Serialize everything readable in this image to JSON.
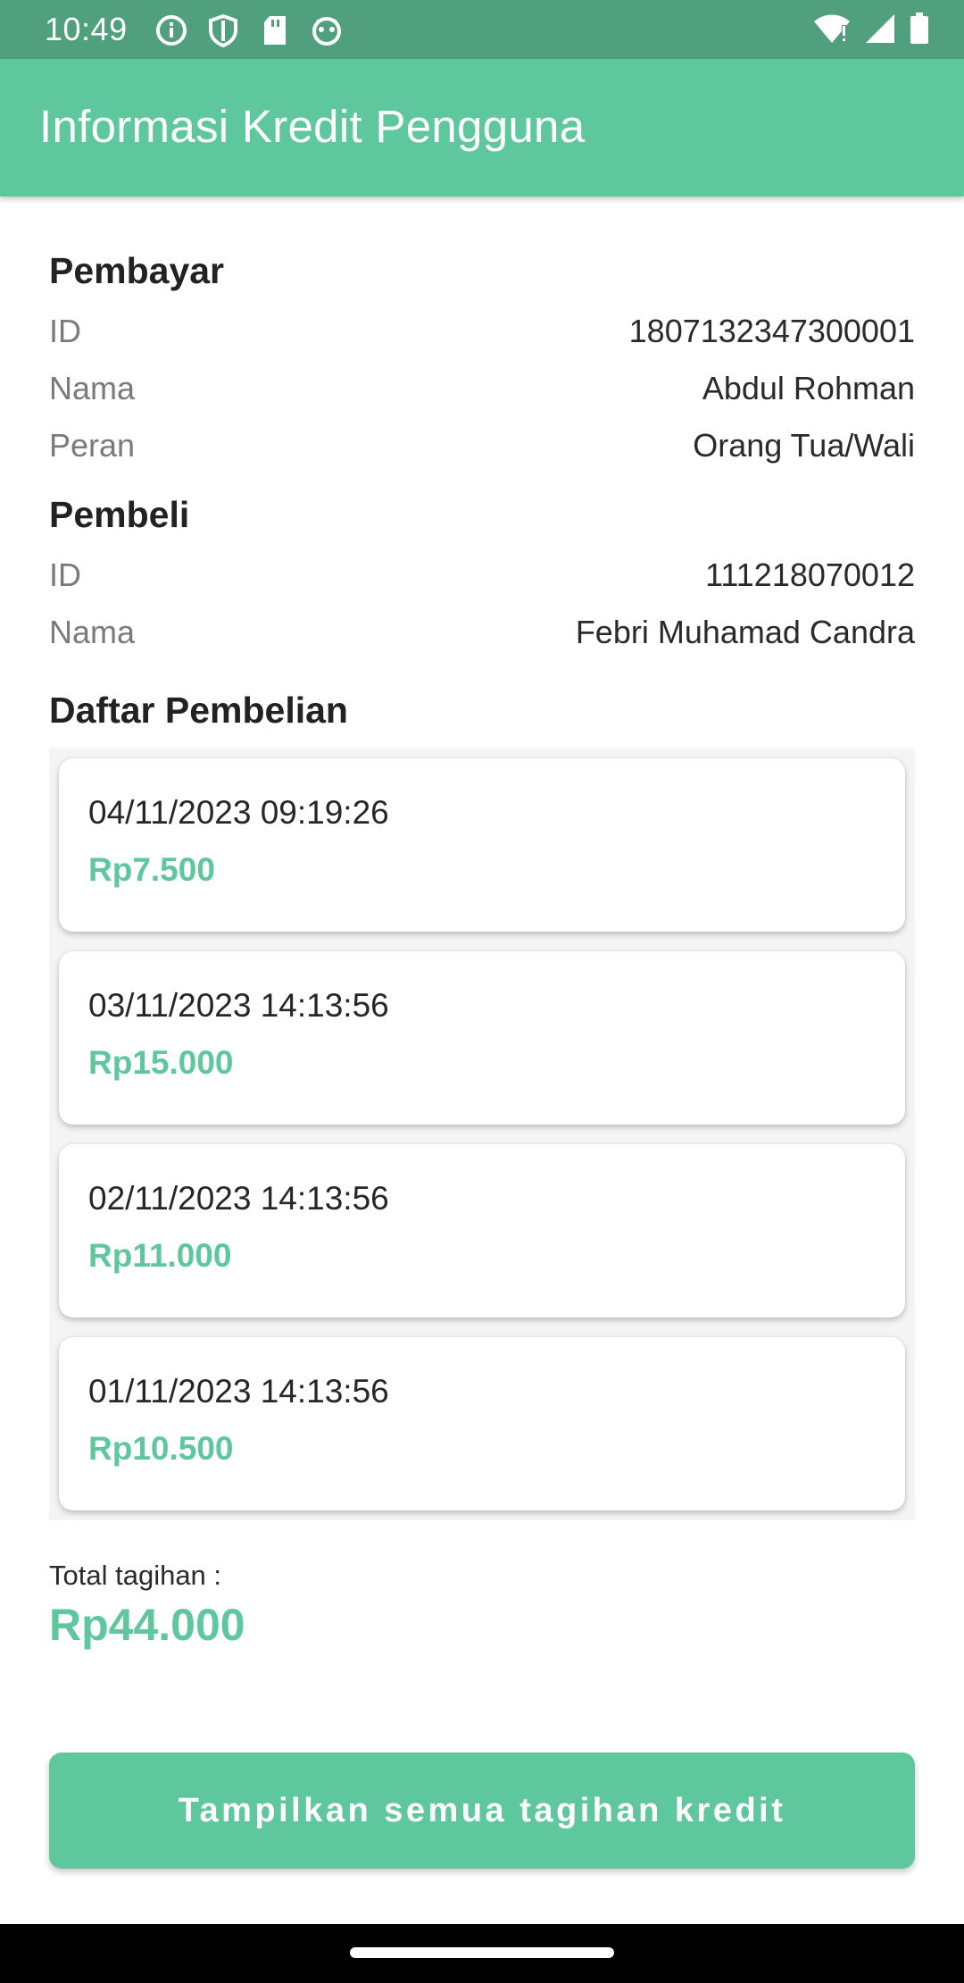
{
  "status_bar": {
    "time": "10:49",
    "left_icons": [
      "info-icon",
      "shield-icon",
      "sd-card-icon",
      "face-icon"
    ],
    "right_icons": [
      "wifi-alert-icon",
      "cell-signal-icon",
      "battery-icon"
    ]
  },
  "app_bar": {
    "title": "Informasi Kredit Pengguna"
  },
  "payer": {
    "title": "Pembayar",
    "id_label": "ID",
    "id_value": "1807132347300001",
    "name_label": "Nama",
    "name_value": "Abdul Rohman",
    "role_label": "Peran",
    "role_value": "Orang Tua/Wali"
  },
  "buyer": {
    "title": "Pembeli",
    "id_label": "ID",
    "id_value": "111218070012",
    "name_label": "Nama",
    "name_value": "Febri Muhamad Candra"
  },
  "purchases": {
    "title": "Daftar Pembelian",
    "items": [
      {
        "date": "04/11/2023 09:19:26",
        "amount": "Rp7.500"
      },
      {
        "date": "03/11/2023 14:13:56",
        "amount": "Rp15.000"
      },
      {
        "date": "02/11/2023 14:13:56",
        "amount": "Rp11.000"
      },
      {
        "date": "01/11/2023 14:13:56",
        "amount": "Rp10.500"
      }
    ]
  },
  "total": {
    "label": "Total tagihan :",
    "value": "Rp44.000"
  },
  "show_all_button": {
    "label": "Tampilkan semua tagihan kredit"
  },
  "colors": {
    "accent": "#5ec79d",
    "status_bar": "#50a07e"
  }
}
